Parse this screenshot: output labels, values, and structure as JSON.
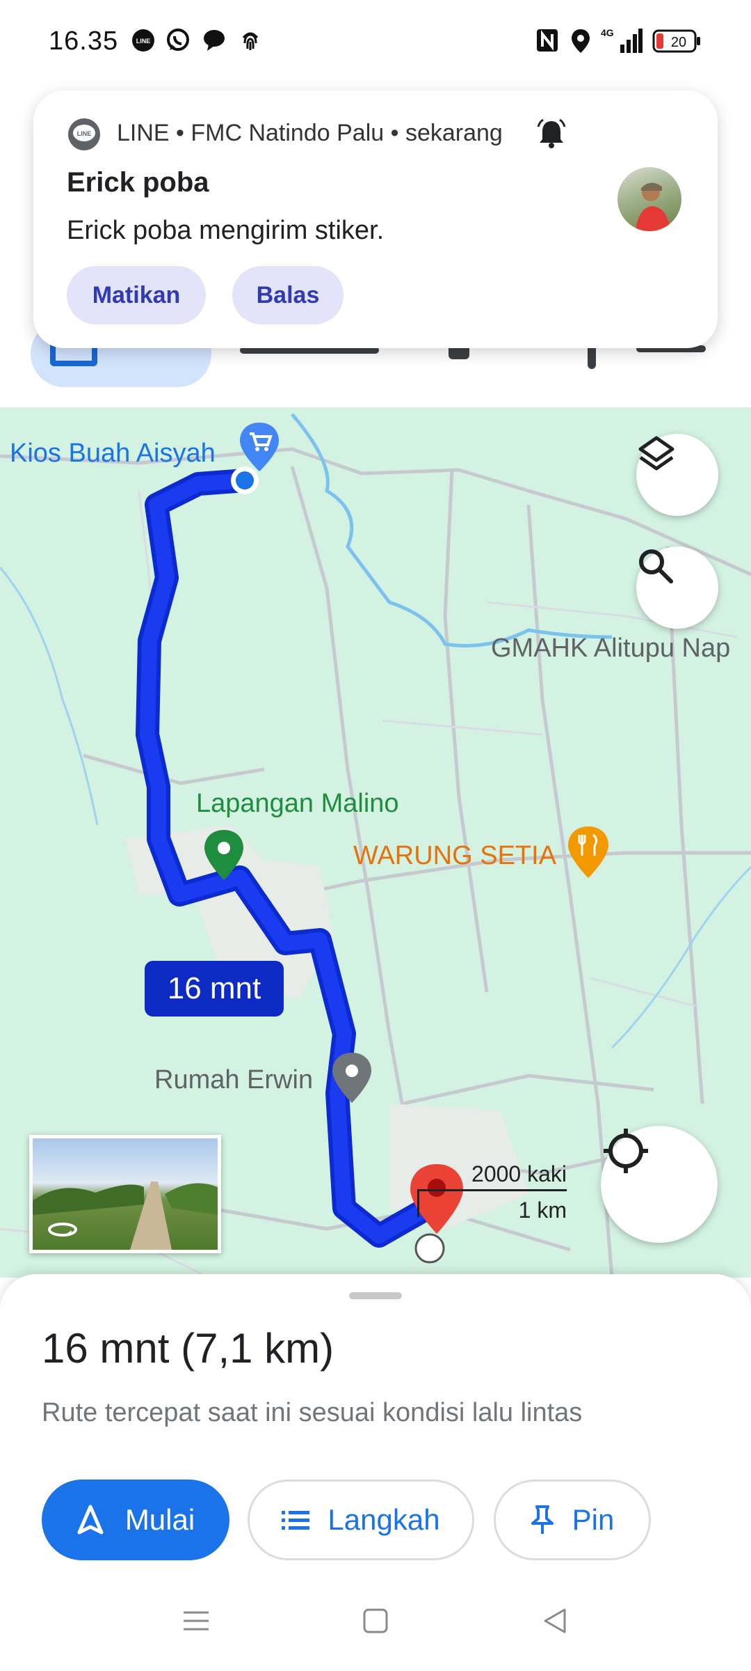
{
  "status_bar": {
    "time": "16.35",
    "left_icons": [
      "line-icon",
      "whatsapp-icon",
      "chat-bubble-icon",
      "fingerprint-icon"
    ],
    "right_icons": [
      "nfc-icon",
      "location-icon",
      "signal-4g-icon"
    ],
    "network": "4G",
    "battery": "20"
  },
  "notification": {
    "header": "LINE • FMC Natindo Palu • sekarang",
    "title": "Erick poba",
    "body": "Erick poba mengirim stiker.",
    "actions": [
      "Matikan",
      "Balas"
    ]
  },
  "map": {
    "labels": {
      "origin": "Kios Buah Aisyah",
      "church": "GMAHK Alitupu Nap",
      "field": "Lapangan Malino",
      "warung": "WARUNG SETIA",
      "house": "Rumah Erwin"
    },
    "route_time_badge": "16 mnt",
    "scale": {
      "feet": "2000 kaki",
      "km": "1 km"
    },
    "colors": {
      "route": "#1a3bf0",
      "map_bg": "#d3f2e1",
      "destination": "#ea4335",
      "badge": "#0d2ac4",
      "warung": "#e8710a",
      "field": "#1e8e3e"
    }
  },
  "sheet": {
    "summary": "16 mnt (7,1 km)",
    "subtitle": "Rute tercepat saat ini sesuai kondisi lalu lintas",
    "buttons": {
      "start": "Mulai",
      "steps": "Langkah",
      "pin": "Pin"
    }
  }
}
